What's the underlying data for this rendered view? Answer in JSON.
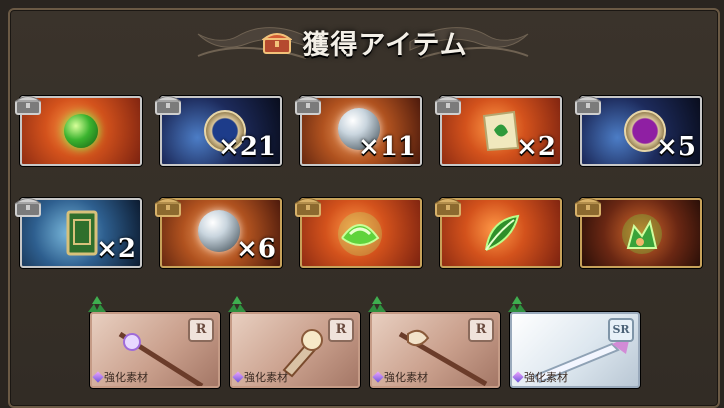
{
  "header": {
    "title": "獲得アイテム",
    "title_icon": "treasure-chest-icon"
  },
  "rows": [
    [
      {
        "icon": "green-orb-icon",
        "qty": "",
        "bg": "orange",
        "chest": "silver"
      },
      {
        "icon": "blue-medal-icon",
        "qty": "×21",
        "bg": "space",
        "chest": "silver"
      },
      {
        "icon": "crystal-orb-icon",
        "qty": "×11",
        "bg": "copper",
        "chest": "silver"
      },
      {
        "icon": "green-scroll-icon",
        "qty": "×2",
        "bg": "orange",
        "chest": "silver"
      },
      {
        "icon": "purple-medal-icon",
        "qty": "×5",
        "bg": "space",
        "chest": "silver"
      }
    ],
    [
      {
        "icon": "green-book-icon",
        "qty": "×2",
        "bg": "earth",
        "chest": "silver"
      },
      {
        "icon": "crystal-orb-icon",
        "qty": "×6",
        "bg": "copper",
        "chest": "gold"
      },
      {
        "icon": "green-spirit-icon",
        "qty": "",
        "bg": "orange",
        "chest": "gold"
      },
      {
        "icon": "green-leaf-icon",
        "qty": "",
        "bg": "orange",
        "chest": "gold"
      },
      {
        "icon": "green-beast-icon",
        "qty": "",
        "bg": "dark",
        "chest": "gold"
      }
    ]
  ],
  "weapons": [
    {
      "icon": "staff-icon",
      "rarity": "R",
      "label": "強化素材"
    },
    {
      "icon": "dagger-icon",
      "rarity": "R",
      "label": "強化素材"
    },
    {
      "icon": "axe-icon",
      "rarity": "R",
      "label": "強化素材"
    },
    {
      "icon": "sword-icon",
      "rarity": "SR",
      "label": "強化素材"
    }
  ]
}
